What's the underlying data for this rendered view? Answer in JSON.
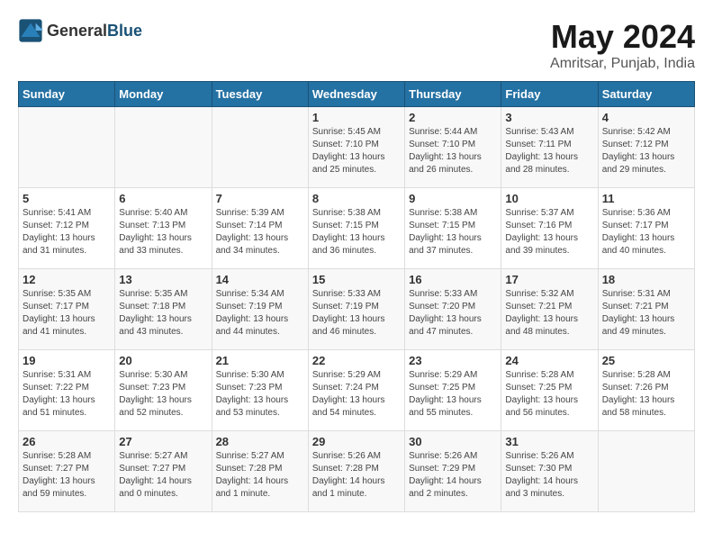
{
  "header": {
    "logo_general": "General",
    "logo_blue": "Blue",
    "title": "May 2024",
    "subtitle": "Amritsar, Punjab, India"
  },
  "calendar": {
    "days_of_week": [
      "Sunday",
      "Monday",
      "Tuesday",
      "Wednesday",
      "Thursday",
      "Friday",
      "Saturday"
    ],
    "weeks": [
      [
        {
          "day": "",
          "info": ""
        },
        {
          "day": "",
          "info": ""
        },
        {
          "day": "",
          "info": ""
        },
        {
          "day": "1",
          "info": "Sunrise: 5:45 AM\nSunset: 7:10 PM\nDaylight: 13 hours and 25 minutes."
        },
        {
          "day": "2",
          "info": "Sunrise: 5:44 AM\nSunset: 7:10 PM\nDaylight: 13 hours and 26 minutes."
        },
        {
          "day": "3",
          "info": "Sunrise: 5:43 AM\nSunset: 7:11 PM\nDaylight: 13 hours and 28 minutes."
        },
        {
          "day": "4",
          "info": "Sunrise: 5:42 AM\nSunset: 7:12 PM\nDaylight: 13 hours and 29 minutes."
        }
      ],
      [
        {
          "day": "5",
          "info": "Sunrise: 5:41 AM\nSunset: 7:12 PM\nDaylight: 13 hours and 31 minutes."
        },
        {
          "day": "6",
          "info": "Sunrise: 5:40 AM\nSunset: 7:13 PM\nDaylight: 13 hours and 33 minutes."
        },
        {
          "day": "7",
          "info": "Sunrise: 5:39 AM\nSunset: 7:14 PM\nDaylight: 13 hours and 34 minutes."
        },
        {
          "day": "8",
          "info": "Sunrise: 5:38 AM\nSunset: 7:15 PM\nDaylight: 13 hours and 36 minutes."
        },
        {
          "day": "9",
          "info": "Sunrise: 5:38 AM\nSunset: 7:15 PM\nDaylight: 13 hours and 37 minutes."
        },
        {
          "day": "10",
          "info": "Sunrise: 5:37 AM\nSunset: 7:16 PM\nDaylight: 13 hours and 39 minutes."
        },
        {
          "day": "11",
          "info": "Sunrise: 5:36 AM\nSunset: 7:17 PM\nDaylight: 13 hours and 40 minutes."
        }
      ],
      [
        {
          "day": "12",
          "info": "Sunrise: 5:35 AM\nSunset: 7:17 PM\nDaylight: 13 hours and 41 minutes."
        },
        {
          "day": "13",
          "info": "Sunrise: 5:35 AM\nSunset: 7:18 PM\nDaylight: 13 hours and 43 minutes."
        },
        {
          "day": "14",
          "info": "Sunrise: 5:34 AM\nSunset: 7:19 PM\nDaylight: 13 hours and 44 minutes."
        },
        {
          "day": "15",
          "info": "Sunrise: 5:33 AM\nSunset: 7:19 PM\nDaylight: 13 hours and 46 minutes."
        },
        {
          "day": "16",
          "info": "Sunrise: 5:33 AM\nSunset: 7:20 PM\nDaylight: 13 hours and 47 minutes."
        },
        {
          "day": "17",
          "info": "Sunrise: 5:32 AM\nSunset: 7:21 PM\nDaylight: 13 hours and 48 minutes."
        },
        {
          "day": "18",
          "info": "Sunrise: 5:31 AM\nSunset: 7:21 PM\nDaylight: 13 hours and 49 minutes."
        }
      ],
      [
        {
          "day": "19",
          "info": "Sunrise: 5:31 AM\nSunset: 7:22 PM\nDaylight: 13 hours and 51 minutes."
        },
        {
          "day": "20",
          "info": "Sunrise: 5:30 AM\nSunset: 7:23 PM\nDaylight: 13 hours and 52 minutes."
        },
        {
          "day": "21",
          "info": "Sunrise: 5:30 AM\nSunset: 7:23 PM\nDaylight: 13 hours and 53 minutes."
        },
        {
          "day": "22",
          "info": "Sunrise: 5:29 AM\nSunset: 7:24 PM\nDaylight: 13 hours and 54 minutes."
        },
        {
          "day": "23",
          "info": "Sunrise: 5:29 AM\nSunset: 7:25 PM\nDaylight: 13 hours and 55 minutes."
        },
        {
          "day": "24",
          "info": "Sunrise: 5:28 AM\nSunset: 7:25 PM\nDaylight: 13 hours and 56 minutes."
        },
        {
          "day": "25",
          "info": "Sunrise: 5:28 AM\nSunset: 7:26 PM\nDaylight: 13 hours and 58 minutes."
        }
      ],
      [
        {
          "day": "26",
          "info": "Sunrise: 5:28 AM\nSunset: 7:27 PM\nDaylight: 13 hours and 59 minutes."
        },
        {
          "day": "27",
          "info": "Sunrise: 5:27 AM\nSunset: 7:27 PM\nDaylight: 14 hours and 0 minutes."
        },
        {
          "day": "28",
          "info": "Sunrise: 5:27 AM\nSunset: 7:28 PM\nDaylight: 14 hours and 1 minute."
        },
        {
          "day": "29",
          "info": "Sunrise: 5:26 AM\nSunset: 7:28 PM\nDaylight: 14 hours and 1 minute."
        },
        {
          "day": "30",
          "info": "Sunrise: 5:26 AM\nSunset: 7:29 PM\nDaylight: 14 hours and 2 minutes."
        },
        {
          "day": "31",
          "info": "Sunrise: 5:26 AM\nSunset: 7:30 PM\nDaylight: 14 hours and 3 minutes."
        },
        {
          "day": "",
          "info": ""
        }
      ]
    ]
  }
}
